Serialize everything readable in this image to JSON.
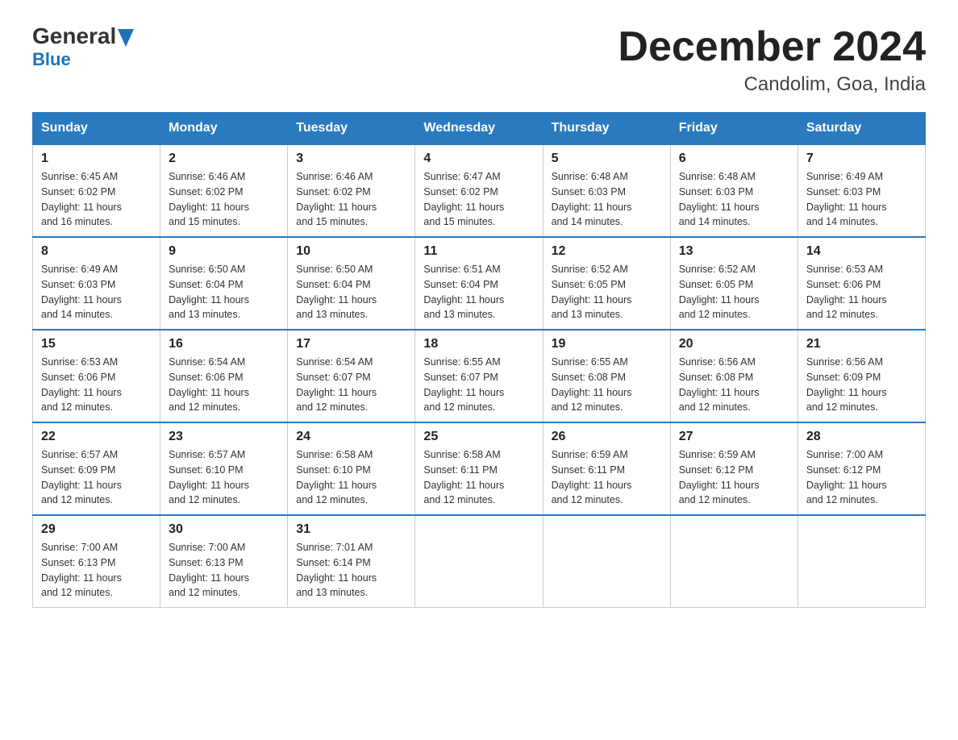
{
  "header": {
    "logo_general": "General",
    "logo_blue": "Blue",
    "calendar_title": "December 2024",
    "calendar_subtitle": "Candolim, Goa, India"
  },
  "weekdays": [
    "Sunday",
    "Monday",
    "Tuesday",
    "Wednesday",
    "Thursday",
    "Friday",
    "Saturday"
  ],
  "weeks": [
    [
      {
        "day": "1",
        "sunrise": "6:45 AM",
        "sunset": "6:02 PM",
        "daylight": "11 hours and 16 minutes."
      },
      {
        "day": "2",
        "sunrise": "6:46 AM",
        "sunset": "6:02 PM",
        "daylight": "11 hours and 15 minutes."
      },
      {
        "day": "3",
        "sunrise": "6:46 AM",
        "sunset": "6:02 PM",
        "daylight": "11 hours and 15 minutes."
      },
      {
        "day": "4",
        "sunrise": "6:47 AM",
        "sunset": "6:02 PM",
        "daylight": "11 hours and 15 minutes."
      },
      {
        "day": "5",
        "sunrise": "6:48 AM",
        "sunset": "6:03 PM",
        "daylight": "11 hours and 14 minutes."
      },
      {
        "day": "6",
        "sunrise": "6:48 AM",
        "sunset": "6:03 PM",
        "daylight": "11 hours and 14 minutes."
      },
      {
        "day": "7",
        "sunrise": "6:49 AM",
        "sunset": "6:03 PM",
        "daylight": "11 hours and 14 minutes."
      }
    ],
    [
      {
        "day": "8",
        "sunrise": "6:49 AM",
        "sunset": "6:03 PM",
        "daylight": "11 hours and 14 minutes."
      },
      {
        "day": "9",
        "sunrise": "6:50 AM",
        "sunset": "6:04 PM",
        "daylight": "11 hours and 13 minutes."
      },
      {
        "day": "10",
        "sunrise": "6:50 AM",
        "sunset": "6:04 PM",
        "daylight": "11 hours and 13 minutes."
      },
      {
        "day": "11",
        "sunrise": "6:51 AM",
        "sunset": "6:04 PM",
        "daylight": "11 hours and 13 minutes."
      },
      {
        "day": "12",
        "sunrise": "6:52 AM",
        "sunset": "6:05 PM",
        "daylight": "11 hours and 13 minutes."
      },
      {
        "day": "13",
        "sunrise": "6:52 AM",
        "sunset": "6:05 PM",
        "daylight": "11 hours and 12 minutes."
      },
      {
        "day": "14",
        "sunrise": "6:53 AM",
        "sunset": "6:06 PM",
        "daylight": "11 hours and 12 minutes."
      }
    ],
    [
      {
        "day": "15",
        "sunrise": "6:53 AM",
        "sunset": "6:06 PM",
        "daylight": "11 hours and 12 minutes."
      },
      {
        "day": "16",
        "sunrise": "6:54 AM",
        "sunset": "6:06 PM",
        "daylight": "11 hours and 12 minutes."
      },
      {
        "day": "17",
        "sunrise": "6:54 AM",
        "sunset": "6:07 PM",
        "daylight": "11 hours and 12 minutes."
      },
      {
        "day": "18",
        "sunrise": "6:55 AM",
        "sunset": "6:07 PM",
        "daylight": "11 hours and 12 minutes."
      },
      {
        "day": "19",
        "sunrise": "6:55 AM",
        "sunset": "6:08 PM",
        "daylight": "11 hours and 12 minutes."
      },
      {
        "day": "20",
        "sunrise": "6:56 AM",
        "sunset": "6:08 PM",
        "daylight": "11 hours and 12 minutes."
      },
      {
        "day": "21",
        "sunrise": "6:56 AM",
        "sunset": "6:09 PM",
        "daylight": "11 hours and 12 minutes."
      }
    ],
    [
      {
        "day": "22",
        "sunrise": "6:57 AM",
        "sunset": "6:09 PM",
        "daylight": "11 hours and 12 minutes."
      },
      {
        "day": "23",
        "sunrise": "6:57 AM",
        "sunset": "6:10 PM",
        "daylight": "11 hours and 12 minutes."
      },
      {
        "day": "24",
        "sunrise": "6:58 AM",
        "sunset": "6:10 PM",
        "daylight": "11 hours and 12 minutes."
      },
      {
        "day": "25",
        "sunrise": "6:58 AM",
        "sunset": "6:11 PM",
        "daylight": "11 hours and 12 minutes."
      },
      {
        "day": "26",
        "sunrise": "6:59 AM",
        "sunset": "6:11 PM",
        "daylight": "11 hours and 12 minutes."
      },
      {
        "day": "27",
        "sunrise": "6:59 AM",
        "sunset": "6:12 PM",
        "daylight": "11 hours and 12 minutes."
      },
      {
        "day": "28",
        "sunrise": "7:00 AM",
        "sunset": "6:12 PM",
        "daylight": "11 hours and 12 minutes."
      }
    ],
    [
      {
        "day": "29",
        "sunrise": "7:00 AM",
        "sunset": "6:13 PM",
        "daylight": "11 hours and 12 minutes."
      },
      {
        "day": "30",
        "sunrise": "7:00 AM",
        "sunset": "6:13 PM",
        "daylight": "11 hours and 12 minutes."
      },
      {
        "day": "31",
        "sunrise": "7:01 AM",
        "sunset": "6:14 PM",
        "daylight": "11 hours and 13 minutes."
      },
      null,
      null,
      null,
      null
    ]
  ]
}
